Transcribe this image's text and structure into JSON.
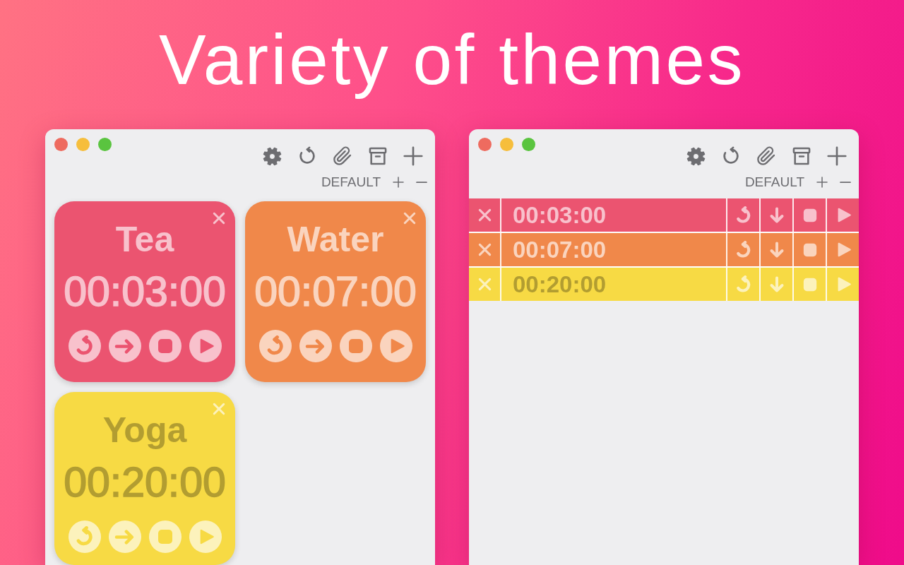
{
  "headline": "Variety of themes",
  "windows": [
    {
      "kind": "cards",
      "profile": "DEFAULT",
      "timers": [
        {
          "name": "Tea",
          "time": "00:03:00",
          "color": "#eb5470"
        },
        {
          "name": "Water",
          "time": "00:07:00",
          "color": "#f0884a"
        },
        {
          "name": "Yoga",
          "time": "00:20:00",
          "color": "#f7da44"
        }
      ]
    },
    {
      "kind": "rows",
      "profile": "DEFAULT",
      "timers": [
        {
          "time": "00:03:00",
          "color": "#eb5470"
        },
        {
          "time": "00:07:00",
          "color": "#f0884a"
        },
        {
          "time": "00:20:00",
          "color": "#f7da44"
        }
      ]
    }
  ]
}
